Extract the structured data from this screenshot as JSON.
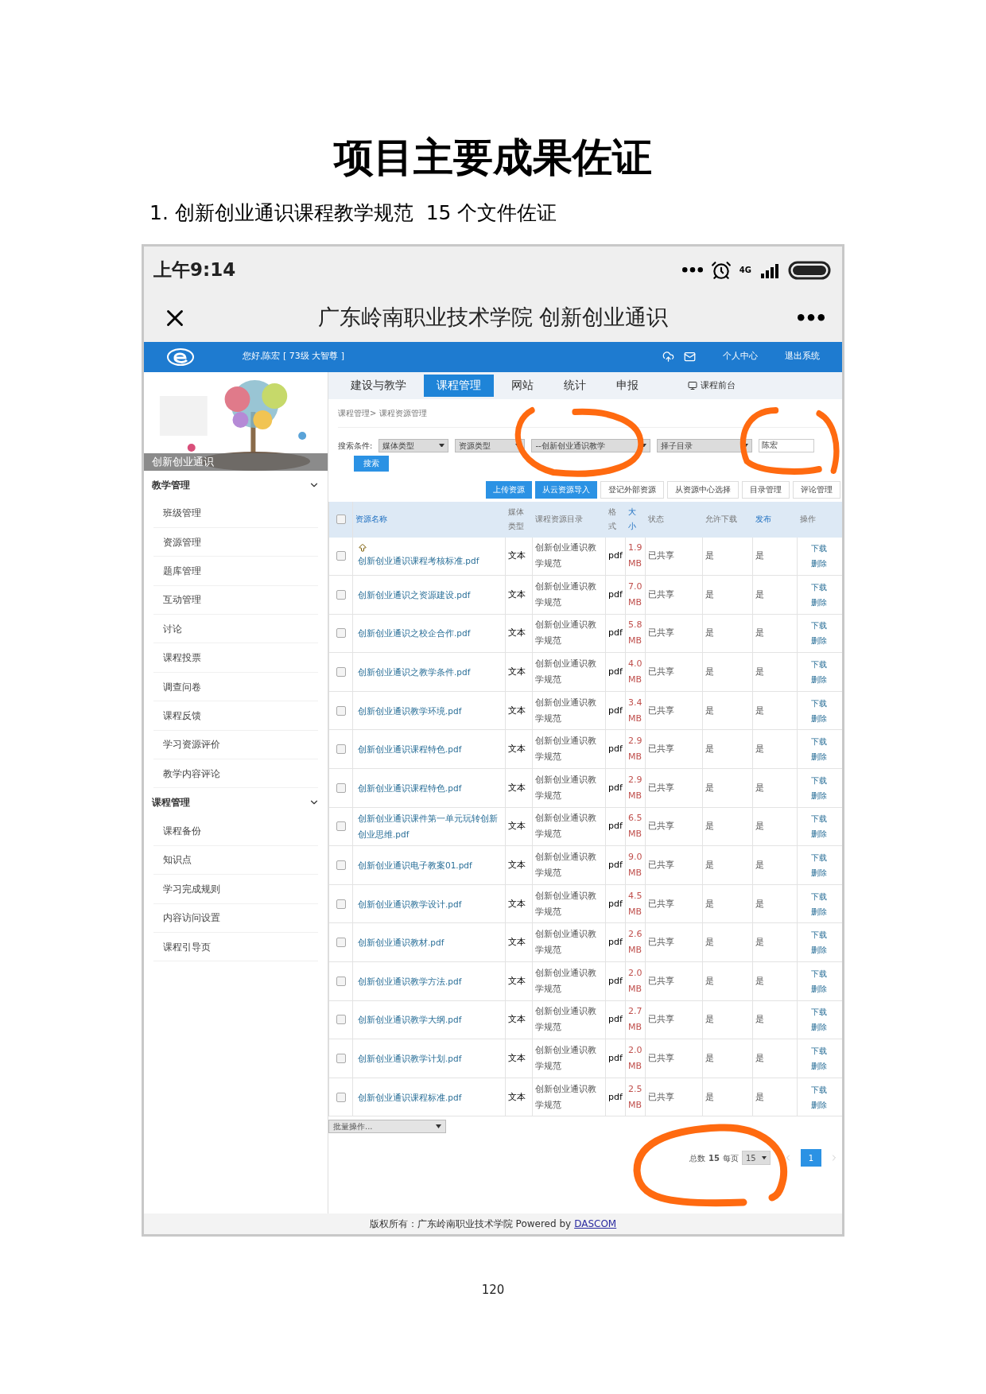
{
  "doc_title": "项目主要成果佐证",
  "doc_subtitle": "1. 创新创业通识课程教学规范  15 个文件佐证",
  "phone": {
    "time": "上午9:14",
    "network": "4G",
    "title": "广东岭南职业技术学院 创新创业通识"
  },
  "header": {
    "greeting": "您好,陈宏 [ 73级 大智尊 ]",
    "links": [
      "个人中心",
      "退出系统"
    ]
  },
  "banner": {
    "kind": "picture",
    "caption": "创新创业通识"
  },
  "sidebar": [
    {
      "label": "教学管理",
      "expanded": true,
      "children": [
        {
          "label": "班级管理"
        },
        {
          "label": "资源管理"
        },
        {
          "label": "题库管理"
        },
        {
          "label": "互动管理"
        },
        {
          "label": "讨论"
        },
        {
          "label": "课程投票"
        },
        {
          "label": "调查问卷"
        },
        {
          "label": "课程反馈"
        },
        {
          "label": "学习资源评价"
        },
        {
          "label": "教学内容评论"
        }
      ]
    },
    {
      "label": "课程管理",
      "expanded": true,
      "children": [
        {
          "label": "课程备份"
        },
        {
          "label": "知识点"
        },
        {
          "label": "学习完成规则"
        },
        {
          "label": "内容访问设置"
        },
        {
          "label": "课程引导页"
        }
      ]
    }
  ],
  "tabs": [
    {
      "label": "建设与教学",
      "selected": false
    },
    {
      "label": "课程管理",
      "selected": true
    },
    {
      "label": "网站",
      "selected": false
    },
    {
      "label": "统计",
      "selected": false
    },
    {
      "label": "申报",
      "selected": false
    }
  ],
  "front_link": "课程前台",
  "breadcrumb": "课程管理> 课程资源管理",
  "search": {
    "label": "搜索条件:",
    "selects": [
      "媒体类型",
      "资源类型",
      "--创新创业通识教学",
      "择子目录"
    ],
    "value": "陈宏",
    "button": "搜索"
  },
  "actions": [
    {
      "label": "上传资源",
      "primary": true
    },
    {
      "label": "从云资源导入",
      "primary": true
    },
    {
      "label": "登记外部资源",
      "primary": false
    },
    {
      "label": "从资源中心选择",
      "primary": false
    },
    {
      "label": "目录管理",
      "primary": false
    },
    {
      "label": "评论管理",
      "primary": false
    }
  ],
  "table": {
    "all_checked": false,
    "columns": [
      {
        "label": "资源名称",
        "sortable": true
      },
      {
        "label": "媒体类型",
        "sortable": false
      },
      {
        "label": "课程资源目录",
        "sortable": false
      },
      {
        "label": "格式",
        "sortable": false
      },
      {
        "label": "大小",
        "sortable": true
      },
      {
        "label": "状态",
        "sortable": false
      },
      {
        "label": "允许下载",
        "sortable": false
      },
      {
        "label": "发布",
        "sortable": true
      },
      {
        "label": "操作",
        "sortable": false
      }
    ],
    "rows": [
      {
        "checked": false,
        "pinned": true,
        "name": "创新创业通识课程考核标准.pdf",
        "media": "文本",
        "catalog": "创新创业通识教学规范",
        "format": "pdf",
        "size": "1.9 MB",
        "status": "已共享",
        "download": "是",
        "publish": "是",
        "ops": [
          "下载",
          "删除"
        ]
      },
      {
        "checked": false,
        "pinned": false,
        "name": "创新创业通识之资源建设.pdf",
        "media": "文本",
        "catalog": "创新创业通识教学规范",
        "format": "pdf",
        "size": "7.0 MB",
        "status": "已共享",
        "download": "是",
        "publish": "是",
        "ops": [
          "下载",
          "删除"
        ]
      },
      {
        "checked": false,
        "pinned": false,
        "name": "创新创业通识之校企合作.pdf",
        "media": "文本",
        "catalog": "创新创业通识教学规范",
        "format": "pdf",
        "size": "5.8 MB",
        "status": "已共享",
        "download": "是",
        "publish": "是",
        "ops": [
          "下载",
          "删除"
        ]
      },
      {
        "checked": false,
        "pinned": false,
        "name": "创新创业通识之教学条件.pdf",
        "media": "文本",
        "catalog": "创新创业通识教学规范",
        "format": "pdf",
        "size": "4.0 MB",
        "status": "已共享",
        "download": "是",
        "publish": "是",
        "ops": [
          "下载",
          "删除"
        ]
      },
      {
        "checked": false,
        "pinned": false,
        "name": "创新创业通识教学环境.pdf",
        "media": "文本",
        "catalog": "创新创业通识教学规范",
        "format": "pdf",
        "size": "3.4 MB",
        "status": "已共享",
        "download": "是",
        "publish": "是",
        "ops": [
          "下载",
          "删除"
        ]
      },
      {
        "checked": false,
        "pinned": false,
        "name": "创新创业通识课程特色.pdf",
        "media": "文本",
        "catalog": "创新创业通识教学规范",
        "format": "pdf",
        "size": "2.9 MB",
        "status": "已共享",
        "download": "是",
        "publish": "是",
        "ops": [
          "下载",
          "删除"
        ]
      },
      {
        "checked": false,
        "pinned": false,
        "name": "创新创业通识课程特色.pdf",
        "media": "文本",
        "catalog": "创新创业通识教学规范",
        "format": "pdf",
        "size": "2.9 MB",
        "status": "已共享",
        "download": "是",
        "publish": "是",
        "ops": [
          "下载",
          "删除"
        ]
      },
      {
        "checked": false,
        "pinned": false,
        "name": "创新创业通识课件第一单元玩转创新创业思维.pdf",
        "media": "文本",
        "catalog": "创新创业通识教学规范",
        "format": "pdf",
        "size": "6.5 MB",
        "status": "已共享",
        "download": "是",
        "publish": "是",
        "ops": [
          "下载",
          "删除"
        ]
      },
      {
        "checked": false,
        "pinned": false,
        "name": "创新创业通识电子教案01.pdf",
        "media": "文本",
        "catalog": "创新创业通识教学规范",
        "format": "pdf",
        "size": "9.0 MB",
        "status": "已共享",
        "download": "是",
        "publish": "是",
        "ops": [
          "下载",
          "删除"
        ]
      },
      {
        "checked": false,
        "pinned": false,
        "name": "创新创业通识教学设计.pdf",
        "media": "文本",
        "catalog": "创新创业通识教学规范",
        "format": "pdf",
        "size": "4.5 MB",
        "status": "已共享",
        "download": "是",
        "publish": "是",
        "ops": [
          "下载",
          "删除"
        ]
      },
      {
        "checked": false,
        "pinned": false,
        "name": "创新创业通识教材.pdf",
        "media": "文本",
        "catalog": "创新创业通识教学规范",
        "format": "pdf",
        "size": "2.6 MB",
        "status": "已共享",
        "download": "是",
        "publish": "是",
        "ops": [
          "下载",
          "删除"
        ]
      },
      {
        "checked": false,
        "pinned": false,
        "name": "创新创业通识教学方法.pdf",
        "media": "文本",
        "catalog": "创新创业通识教学规范",
        "format": "pdf",
        "size": "2.0 MB",
        "status": "已共享",
        "download": "是",
        "publish": "是",
        "ops": [
          "下载",
          "删除"
        ]
      },
      {
        "checked": false,
        "pinned": false,
        "name": "创新创业通识教学大纲.pdf",
        "media": "文本",
        "catalog": "创新创业通识教学规范",
        "format": "pdf",
        "size": "2.7 MB",
        "status": "已共享",
        "download": "是",
        "publish": "是",
        "ops": [
          "下载",
          "删除"
        ]
      },
      {
        "checked": false,
        "pinned": false,
        "name": "创新创业通识教学计划.pdf",
        "media": "文本",
        "catalog": "创新创业通识教学规范",
        "format": "pdf",
        "size": "2.0 MB",
        "status": "已共享",
        "download": "是",
        "publish": "是",
        "ops": [
          "下载",
          "删除"
        ]
      },
      {
        "checked": false,
        "pinned": false,
        "name": "创新创业通识课程标准.pdf",
        "media": "文本",
        "catalog": "创新创业通识教学规范",
        "format": "pdf",
        "size": "2.5 MB",
        "status": "已共享",
        "download": "是",
        "publish": "是",
        "ops": [
          "下载",
          "删除"
        ]
      }
    ]
  },
  "bulk": "批量操作...",
  "pagination": {
    "total_label": "总数",
    "total": "15",
    "per_page_label": "每页",
    "per_page": "15",
    "pages": [
      {
        "label": "1",
        "selected": true
      }
    ]
  },
  "footer": {
    "text": "版权所有：广东岭南职业技术学院 Powered by",
    "link": "DASCOM"
  },
  "page_number": "120"
}
